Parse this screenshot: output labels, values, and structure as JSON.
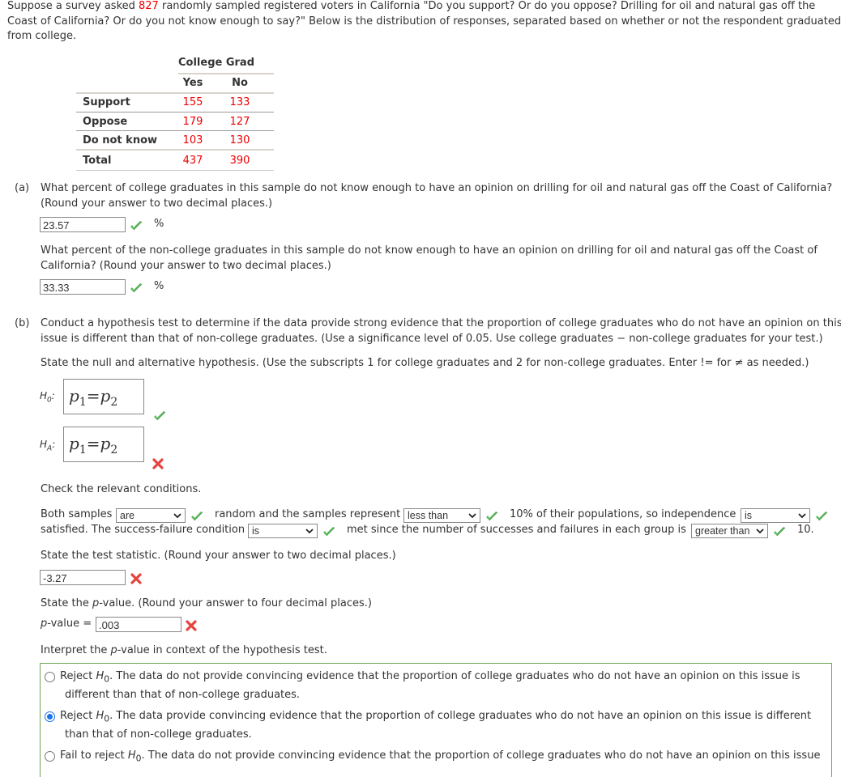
{
  "intro": {
    "line1_pre": "Suppose a survey asked ",
    "sample_size": "827",
    "line1_post": " randomly sampled registered voters in California \"Do you support? Or do you oppose? Drilling for oil and natural gas off the",
    "line2": "Coast of California? Or do you not know enough to say?\" Below is the distribution of responses, separated based on whether or not the respondent graduated",
    "line3": "from college."
  },
  "table": {
    "group_header": "College Grad",
    "columns": [
      "Yes",
      "No"
    ],
    "rows": [
      {
        "label": "Support",
        "values": [
          "155",
          "133"
        ]
      },
      {
        "label": "Oppose",
        "values": [
          "179",
          "127"
        ]
      },
      {
        "label": "Do not know",
        "values": [
          "103",
          "130"
        ]
      },
      {
        "label": "Total",
        "values": [
          "437",
          "390"
        ]
      }
    ]
  },
  "part_a": {
    "tag": "(a)",
    "q1_line1": "What percent of college graduates in this sample do not know enough to have an opinion on drilling for oil and natural gas off the Coast of California?",
    "q1_line2": "(Round your answer to two decimal places.)",
    "q1_answer": "23.57",
    "q1_status": "correct",
    "unit": "%",
    "q2_line1": "What percent of the non-college graduates in this sample do not know enough to have an opinion on drilling for oil and natural gas off the Coast of",
    "q2_line2": "California? (Round your answer to two decimal places.)",
    "q2_answer": "33.33",
    "q2_status": "correct"
  },
  "part_b": {
    "tag": "(b)",
    "intro_line1": "Conduct a hypothesis test to determine if the data provide strong evidence that the proportion of college graduates who do not have an opinion on this",
    "intro_line2": "issue is different than that of non-college graduates. (Use a significance level of 0.05. Use college graduates − non-college graduates for your test.)",
    "hyp_prompt": "State the null and alternative hypothesis. (Use the subscripts 1 for college graduates and 2 for non-college graduates. Enter != for ≠ as needed.)",
    "h0": {
      "label": "H",
      "sub": "0",
      "lhs": "p",
      "lhs_sub": "1",
      "op": "=",
      "rhs": "p",
      "rhs_sub": "2",
      "status": "correct"
    },
    "ha": {
      "label": "H",
      "sub": "A",
      "lhs": "p",
      "lhs_sub": "1",
      "op": "=",
      "rhs": "p",
      "rhs_sub": "2",
      "status": "incorrect"
    },
    "conditions_prompt": "Check the relevant conditions.",
    "cond": {
      "t1": "Both samples",
      "s1": "are",
      "t2": "random and the samples represent",
      "s2": "less than",
      "t3": "10% of their populations, so independence",
      "s3": "is",
      "t4": "satisfied. The success-failure condition",
      "s4": "is",
      "t5": "met since the number of successes and failures in each group is",
      "s5": "greater than",
      "t6": "10."
    },
    "stat_prompt": "State the test statistic. (Round your answer to two decimal places.)",
    "stat_answer": "-3.27",
    "stat_status": "incorrect",
    "p_prompt_pre": "State the ",
    "p_var": "p",
    "p_prompt_post": "-value. (Round your answer to four decimal places.)",
    "p_label_post": "-value =",
    "p_answer": ".003",
    "p_status": "incorrect",
    "interp_pre": "Interpret the ",
    "interp_post": "-value in context of the hypothesis test.",
    "options": [
      {
        "lead": "Reject ",
        "h": "H",
        "hsub": "0",
        "line1": ". The data do not provide convincing evidence that the proportion of college graduates who do not have an opinion on this issue is",
        "line2": "different than that of non-college graduates.",
        "selected": false
      },
      {
        "lead": "Reject ",
        "h": "H",
        "hsub": "0",
        "line1": ". The data provide convincing evidence that the proportion of college graduates who do not have an opinion on this issue is different",
        "line2": "than that of non-college graduates.",
        "selected": true
      },
      {
        "lead": "Fail to reject ",
        "h": "H",
        "hsub": "0",
        "line1": ". The data do not provide convincing evidence that the proportion of college graduates who do not have an opinion on this issue",
        "line2": "",
        "selected": false
      }
    ]
  },
  "colors": {
    "correct": "#5cb85c",
    "incorrect": "#e8423f",
    "value_red": "#ee0000",
    "option_border": "#6aa84f",
    "radio_selected": "#1a73e8"
  }
}
